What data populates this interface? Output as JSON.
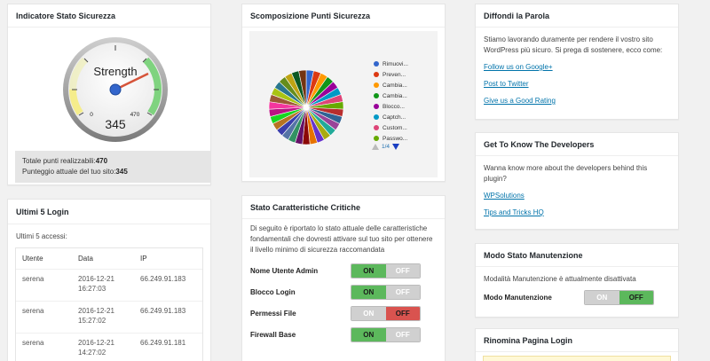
{
  "security_indicator": {
    "title": "Indicatore Stato Sicurezza",
    "gauge_label": "Strength",
    "gauge_min": "0",
    "gauge_max": "470",
    "gauge_value": "345",
    "total_points_label": "Totale punti realizzabili:",
    "total_points": "470",
    "current_points_label": "Punteggio attuale del tuo sito:",
    "current_points": "345"
  },
  "last_logins": {
    "title": "Ultimi 5 Login",
    "subtitle": "Ultimi 5 accessi:",
    "columns": [
      "Utente",
      "Data",
      "IP"
    ],
    "rows": [
      {
        "user": "serena",
        "date": "2016-12-21",
        "time": "16:27:03",
        "ip": "66.249.91.183"
      },
      {
        "user": "serena",
        "date": "2016-12-21",
        "time": "15:27:02",
        "ip": "66.249.91.183"
      },
      {
        "user": "serena",
        "date": "2016-12-21",
        "time": "14:27:02",
        "ip": "66.249.91.181"
      }
    ]
  },
  "points_breakdown": {
    "title": "Scomposizione Punti Sicurezza",
    "legend": [
      {
        "label": "Rimuovi...",
        "color": "#3366cc"
      },
      {
        "label": "Preven...",
        "color": "#dc3912"
      },
      {
        "label": "Cambia...",
        "color": "#ff9900"
      },
      {
        "label": "Cambia...",
        "color": "#109618"
      },
      {
        "label": "Blocco...",
        "color": "#990099"
      },
      {
        "label": "Captch...",
        "color": "#0099c6"
      },
      {
        "label": "Custom...",
        "color": "#dd4477"
      },
      {
        "label": "Passwo...",
        "color": "#66aa00"
      }
    ],
    "pager": "1/4",
    "slice_colors": [
      "#3366cc",
      "#dc3912",
      "#ff9900",
      "#109618",
      "#990099",
      "#0099c6",
      "#dd4477",
      "#66aa00",
      "#b82e2e",
      "#316395",
      "#994499",
      "#22aa99",
      "#aaaa11",
      "#6633cc",
      "#e67300",
      "#8b0707",
      "#651067",
      "#329262",
      "#5574a6",
      "#3b3eac",
      "#b77322",
      "#16d620",
      "#b91383",
      "#f4359e",
      "#9c5935",
      "#a9c413",
      "#2a778d",
      "#668d1c",
      "#bea413",
      "#0c5922",
      "#743411"
    ]
  },
  "critical_features": {
    "title": "Stato Caratteristiche Critiche",
    "description": "Di seguito è riportato lo stato attuale delle caratteristiche fondamentali che dovresti attivare sul tuo sito per ottenere il livello minimo di sicurezza raccomandata",
    "on_label": "ON",
    "off_label": "OFF",
    "features": [
      {
        "label": "Nome Utente Admin",
        "state": "on"
      },
      {
        "label": "Blocco Login",
        "state": "on"
      },
      {
        "label": "Permessi File",
        "state": "off"
      },
      {
        "label": "Firewall Base",
        "state": "on"
      }
    ]
  },
  "spread_word": {
    "title": "Diffondi la Parola",
    "text": "Stiamo lavorando duramente per rendere il vostro sito WordPress più sicuro. Si prega di sostenere, ecco come:",
    "links": [
      "Follow us on Google+",
      "Post to Twitter",
      "Give us a Good Rating"
    ]
  },
  "developers": {
    "title": "Get To Know The Developers",
    "text": "Wanna know more about the developers behind this plugin?",
    "links": [
      "WPSolutions",
      "Tips and Tricks HQ"
    ]
  },
  "maintenance": {
    "title": "Modo Stato Manutenzione",
    "text": "Modalità Manutenzione è attualmente disattivata",
    "label": "Modo Manutenzione",
    "on_label": "ON",
    "off_label": "OFF"
  },
  "rename_login": {
    "title": "Rinomina Pagina Login"
  }
}
